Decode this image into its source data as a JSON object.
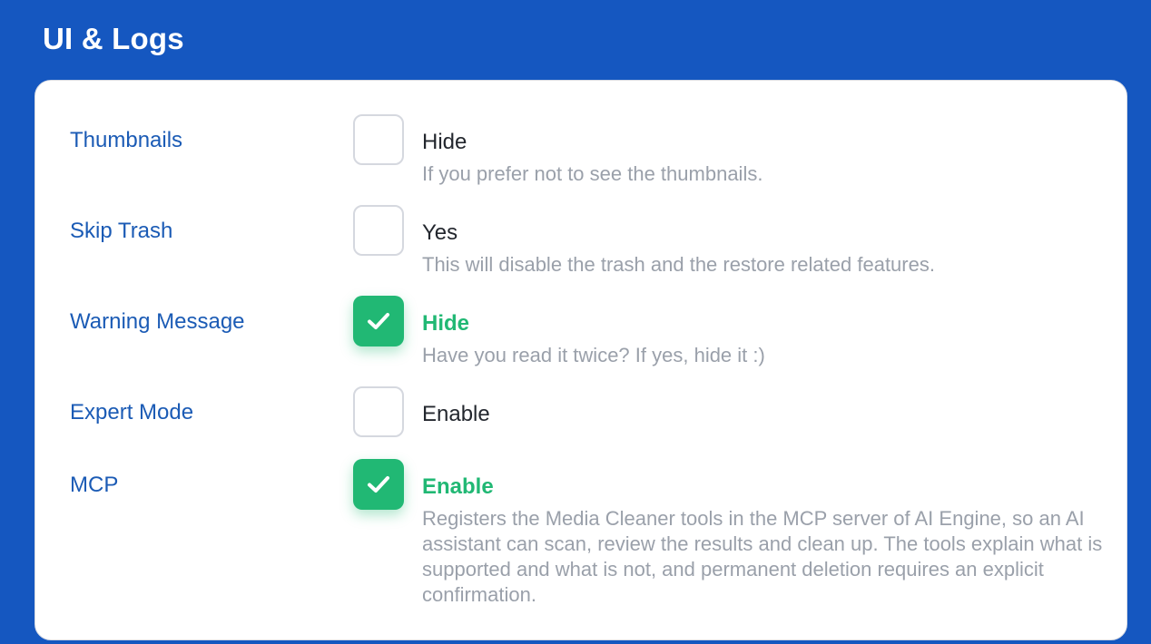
{
  "panel": {
    "title": "UI & Logs"
  },
  "settings": [
    {
      "label": "Thumbnails",
      "checked": false,
      "option": "Hide",
      "description": "If you prefer not to see the thumbnails."
    },
    {
      "label": "Skip Trash",
      "checked": false,
      "option": "Yes",
      "description": "This will disable the trash and the restore related features."
    },
    {
      "label": "Warning Message",
      "checked": true,
      "option": "Hide",
      "description": "Have you read it twice? If yes, hide it :)"
    },
    {
      "label": "Expert Mode",
      "checked": false,
      "option": "Enable",
      "description": ""
    },
    {
      "label": "MCP",
      "checked": true,
      "option": "Enable",
      "description": "Registers the Media Cleaner tools in the MCP server of AI Engine, so an AI assistant can scan, review the results and clean up. The tools explain what is supported and what is not, and permanent deletion requires an explicit confirmation."
    }
  ],
  "colors": {
    "background": "#1557c0",
    "label": "#1b5bb5",
    "checked": "#21b874",
    "description": "#9aa0aa"
  },
  "icons": {
    "checkmark": "check-icon"
  }
}
